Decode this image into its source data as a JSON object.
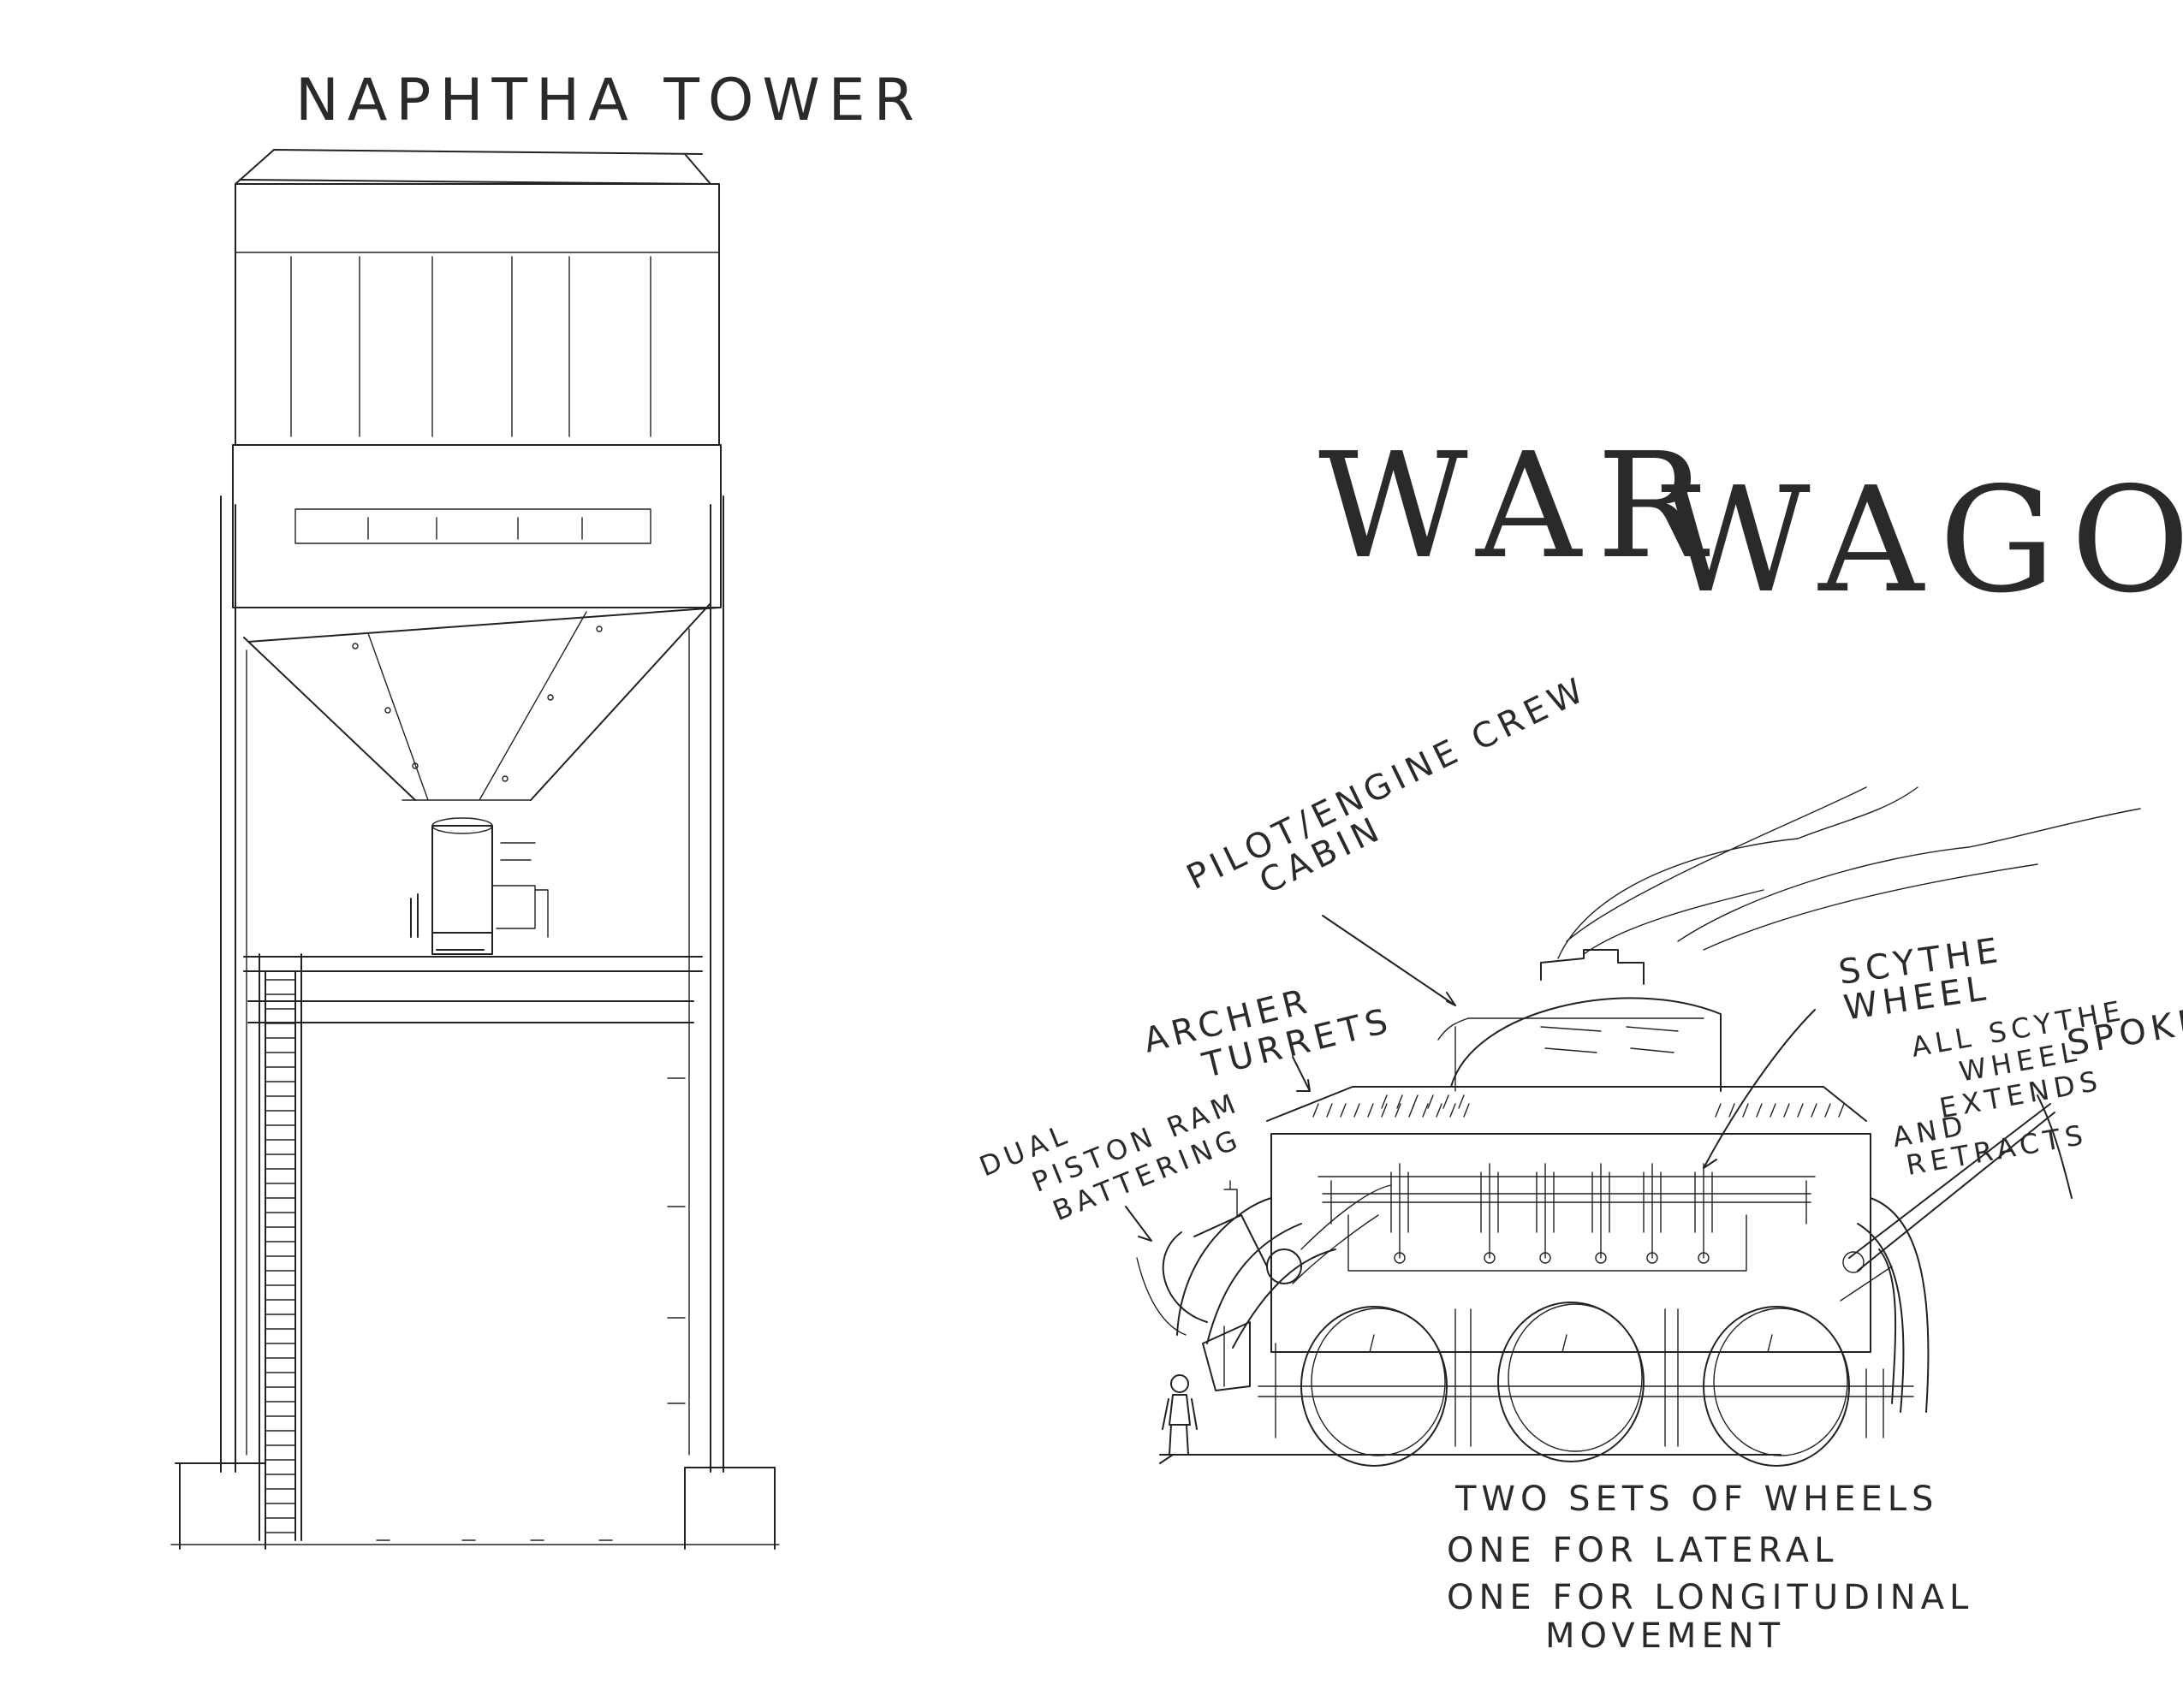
{
  "tower": {
    "title": "NAPHTHA TOWER"
  },
  "wagon": {
    "title_word1": "WAR",
    "title_word2": "WAGON",
    "label_cabin_line1": "PILOT/ENGINE CREW",
    "label_cabin_line2": "CABIN",
    "label_scythe_line1": "SCYTHE",
    "label_scythe_line2": "WHEEL",
    "label_archer_line1": "ARCHER",
    "label_archer_line2": "TURRETS",
    "label_ram_line1": "DUAL",
    "label_ram_line2": "PISTON",
    "label_ram_line3": "BATTERING",
    "label_ram_line4": "RAM",
    "label_spokes_line1": "ALL SCYTHE",
    "label_spokes_line2": "WHEEL",
    "label_spokes_line3": "SPOKES",
    "label_spokes_line4": "EXTENDS",
    "label_spokes_line5": "AND",
    "label_spokes_line6": "RETRACTS",
    "note_line1": "TWO SETS OF WHEELS",
    "note_line2": "ONE FOR LATERAL",
    "note_line3": "ONE FOR LONGITUDINAL",
    "note_line4": "MOVEMENT"
  },
  "colors": {
    "ink": "#222222",
    "paper": "#ffffff"
  }
}
